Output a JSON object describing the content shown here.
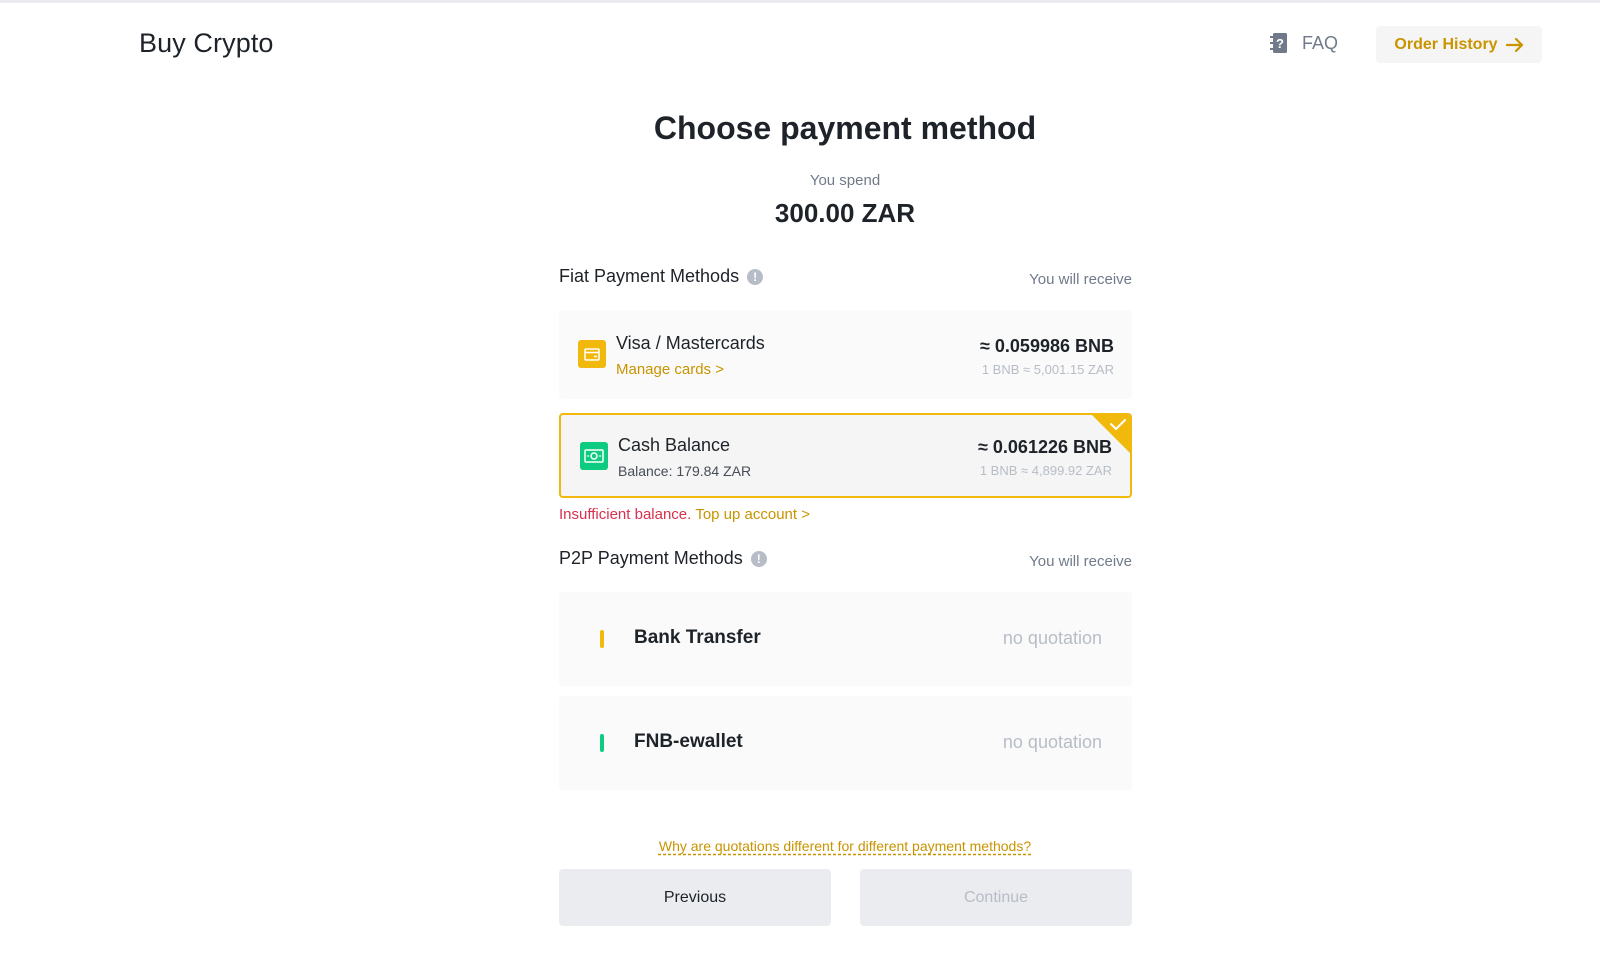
{
  "header": {
    "title": "Buy Crypto",
    "faq_label": "FAQ",
    "order_history_label": "Order History"
  },
  "main": {
    "title": "Choose payment method",
    "spend_label": "You spend",
    "spend_amount": "300.00 ZAR"
  },
  "fiat": {
    "section_title": "Fiat Payment Methods",
    "receive_label": "You will receive",
    "methods": [
      {
        "name": "Visa / Mastercards",
        "sub": "Manage cards >",
        "amount": "≈ 0.059986 BNB",
        "rate": "1 BNB ≈ 5,001.15 ZAR",
        "icon": "card-icon",
        "selected": false
      },
      {
        "name": "Cash Balance",
        "sub": "Balance: 179.84 ZAR",
        "amount": "≈ 0.061226 BNB",
        "rate": "1 BNB ≈ 4,899.92 ZAR",
        "icon": "cash-icon",
        "selected": true
      }
    ],
    "error_text": "Insufficient balance.",
    "topup_label": "Top up account >"
  },
  "p2p": {
    "section_title": "P2P Payment Methods",
    "receive_label": "You will receive",
    "methods": [
      {
        "name": "Bank Transfer",
        "quote": "no quotation",
        "color": "#f0b90b"
      },
      {
        "name": "FNB-ewallet",
        "quote": "no quotation",
        "color": "#0ecb81"
      }
    ]
  },
  "footer": {
    "why_link": "Why are quotations different for different payment methods?",
    "previous_label": "Previous",
    "continue_label": "Continue"
  },
  "colors": {
    "accent": "#f0b90b",
    "accent_text": "#c99400",
    "error": "#d9304e",
    "success": "#0ecb81"
  }
}
